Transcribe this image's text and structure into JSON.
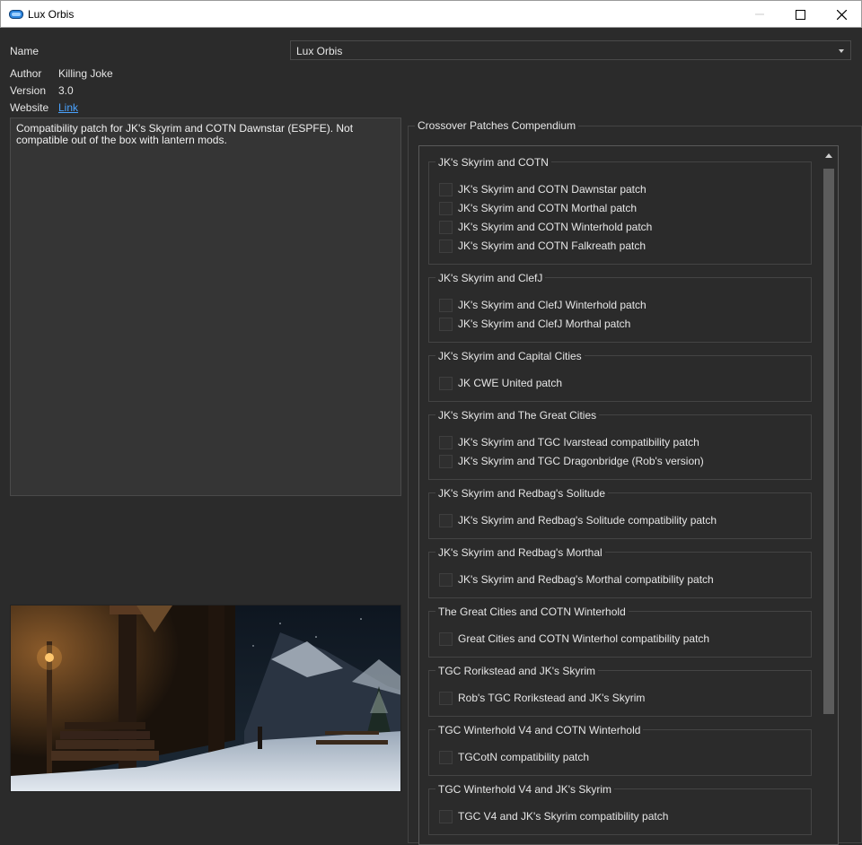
{
  "window": {
    "title": "Lux Orbis",
    "icon": "app-logo-icon",
    "controls": [
      "minimize-icon",
      "maximize-icon",
      "close-icon"
    ]
  },
  "info": {
    "name_label": "Name",
    "name_value": "Lux Orbis",
    "author_label": "Author",
    "author_value": "Killing Joke",
    "version_label": "Version",
    "version_value": "3.0",
    "website_label": "Website",
    "website_link": "Link"
  },
  "description": "Compatibility patch for JK's Skyrim and COTN Dawnstar (ESPFE). Not compatible out of the box with lantern mods.",
  "options_title": "Crossover Patches Compendium",
  "groups": [
    {
      "title": "JK's Skyrim and COTN",
      "options": [
        "JK's Skyrim and COTN Dawnstar patch",
        "JK's Skyrim and COTN Morthal patch",
        "JK's Skyrim and COTN Winterhold patch",
        "JK's Skyrim and COTN Falkreath patch"
      ]
    },
    {
      "title": "JK's Skyrim and ClefJ",
      "options": [
        "JK's Skyrim and ClefJ Winterhold patch",
        "JK's Skyrim and ClefJ Morthal patch"
      ]
    },
    {
      "title": "JK's Skyrim and Capital Cities",
      "options": [
        "JK CWE United patch"
      ]
    },
    {
      "title": "JK's Skyrim and The Great Cities",
      "options": [
        "JK's Skyrim and TGC Ivarstead compatibility patch",
        "JK's Skyrim and TGC Dragonbridge (Rob's version)"
      ]
    },
    {
      "title": "JK's Skyrim and Redbag's Solitude",
      "options": [
        "JK's Skyrim and Redbag's Solitude compatibility patch"
      ]
    },
    {
      "title": "JK's Skyrim and Redbag's Morthal",
      "options": [
        "JK's Skyrim and Redbag's Morthal compatibility patch"
      ]
    },
    {
      "title": "The Great Cities and COTN Winterhold",
      "options": [
        "Great Cities and COTN Winterhol compatibility patch"
      ]
    },
    {
      "title": "TGC Rorikstead and JK's Skyrim",
      "options": [
        "Rob's TGC Rorikstead and JK's Skyrim"
      ]
    },
    {
      "title": "TGC Winterhold V4 and COTN Winterhold",
      "options": [
        "TGCotN compatibility patch"
      ]
    },
    {
      "title": "TGC Winterhold V4 and JK's Skyrim",
      "options": [
        "TGC V4 and JK's Skyrim compatibility patch"
      ]
    }
  ]
}
